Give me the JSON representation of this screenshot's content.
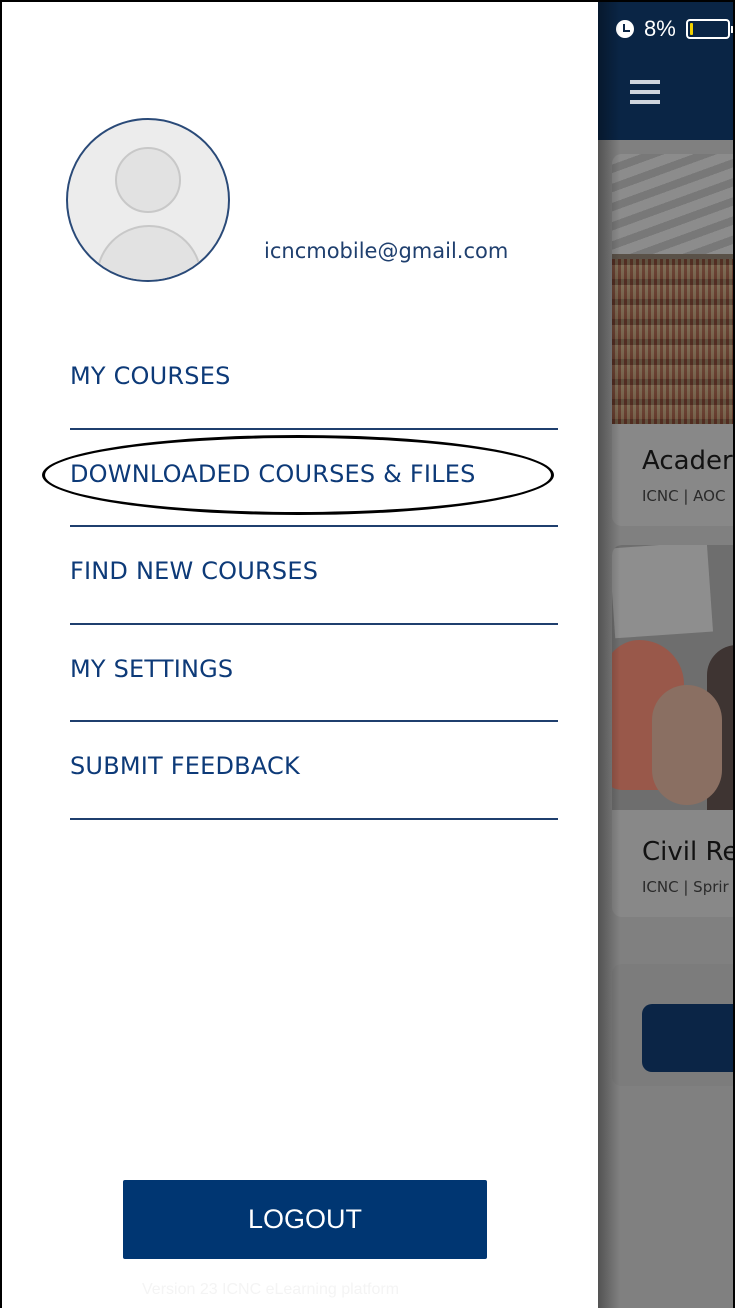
{
  "drawer": {
    "email": "icncmobile@gmail.com",
    "menu": [
      {
        "label": "MY COURSES"
      },
      {
        "label": "DOWNLOADED COURSES & FILES",
        "circled": true
      },
      {
        "label": "FIND NEW COURSES"
      },
      {
        "label": "MY SETTINGS"
      },
      {
        "label": "SUBMIT FEEDBACK"
      }
    ],
    "logout_label": "LOGOUT",
    "version_text": "Version 23 ICNC eLearning platform"
  },
  "status_bar": {
    "battery_text": "8%",
    "battery_level": 0.08,
    "icons": [
      "alarm-icon",
      "battery-icon"
    ]
  },
  "background_app": {
    "nav_icon": "hamburger-icon",
    "cards": [
      {
        "title": "Acader",
        "subtitle": "ICNC | AOC"
      },
      {
        "title": "Civil Re",
        "subtitle": "ICNC | Sprir"
      }
    ]
  },
  "colors": {
    "primary": "#003672",
    "menu_text": "#0d3a78",
    "divider": "#1f3f6e",
    "header": "#0a2545",
    "battery_fill": "#f2d100"
  }
}
